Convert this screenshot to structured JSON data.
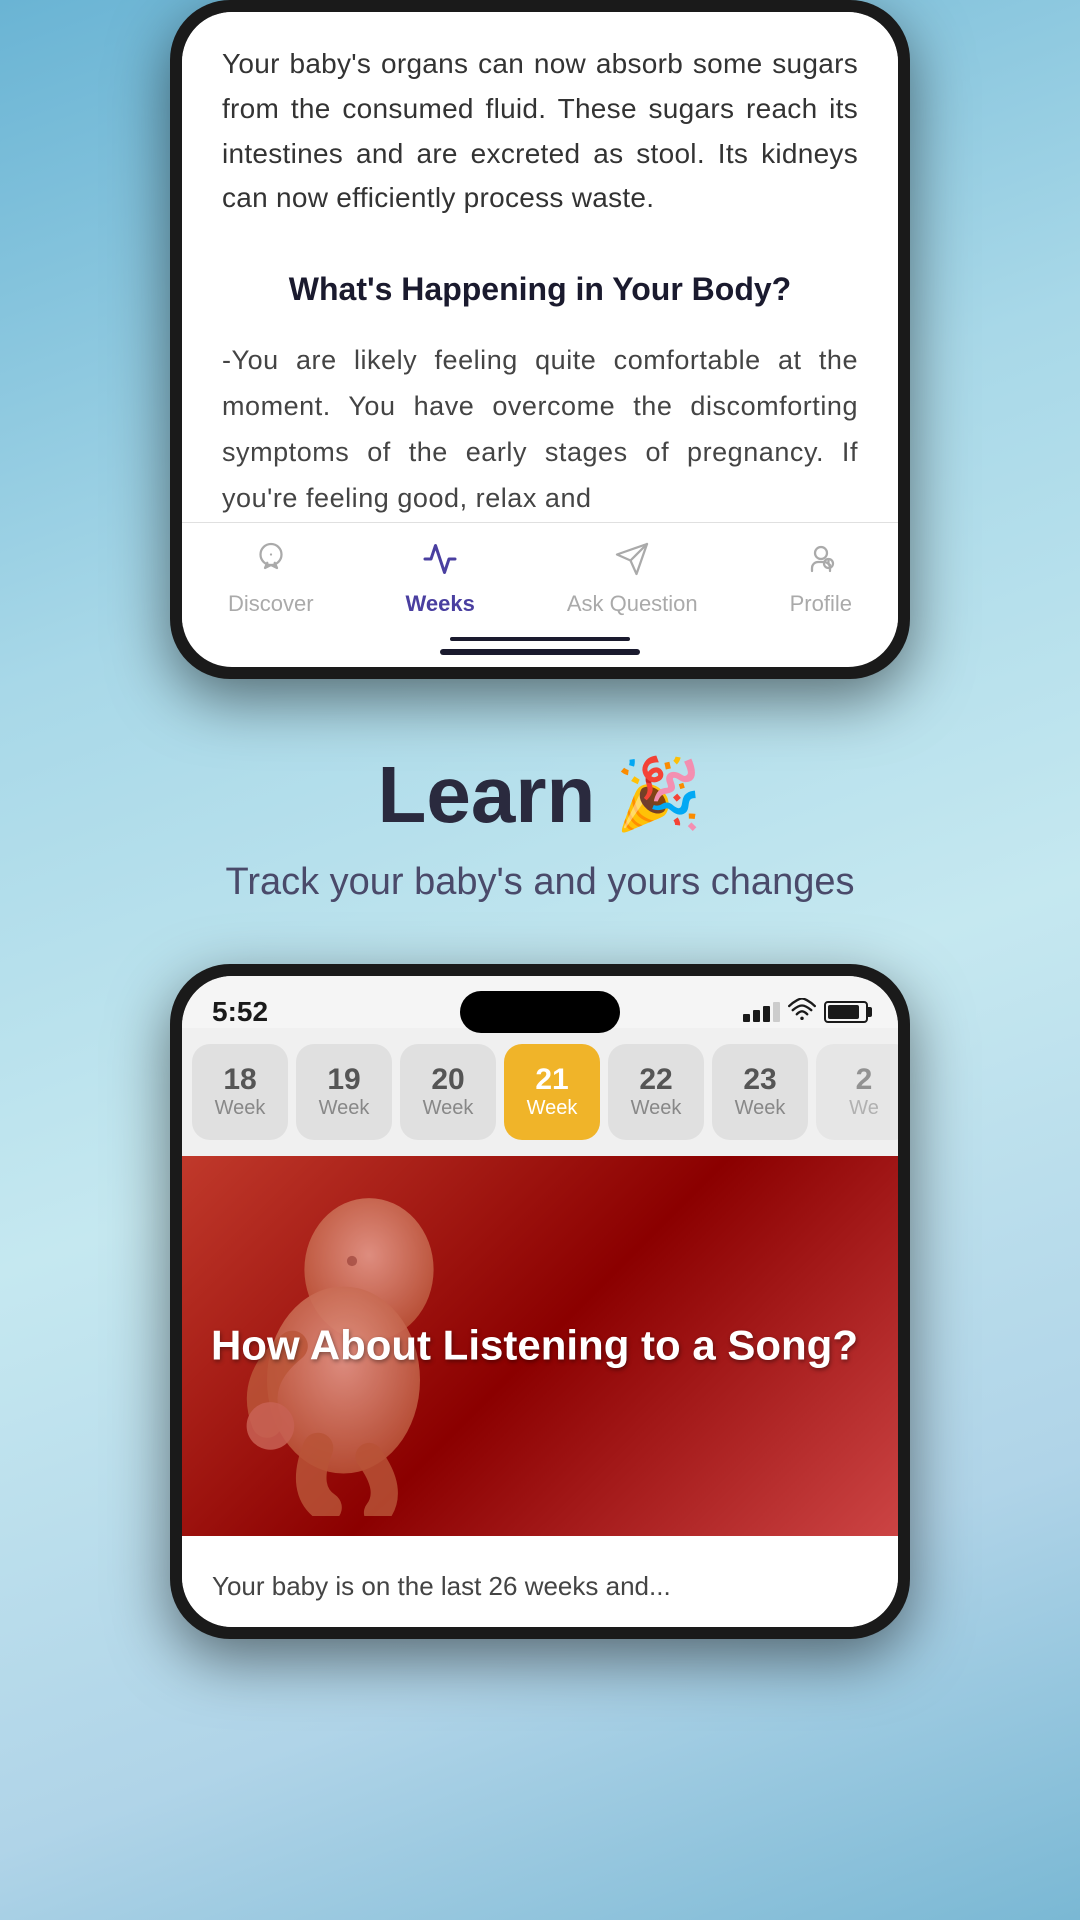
{
  "background": {
    "gradient_start": "#6ab4d4",
    "gradient_end": "#7ab8d4"
  },
  "top_phone": {
    "article_top": "Your baby's organs can now absorb some sugars from the consumed fluid. These sugars reach its intestines and are excreted as stool. Its kidneys can now efficiently process waste.",
    "section_heading": "What's Happening in Your Body?",
    "article_body": "-You are likely feeling quite comfortable at the moment. You have overcome the discomforting symptoms of the early stages of pregnancy. If you're feeling good, relax and"
  },
  "tab_bar": {
    "items": [
      {
        "id": "discover",
        "label": "Discover",
        "active": false
      },
      {
        "id": "weeks",
        "label": "Weeks",
        "active": true
      },
      {
        "id": "ask_question",
        "label": "Ask Question",
        "active": false
      },
      {
        "id": "profile",
        "label": "Profile",
        "active": false
      }
    ]
  },
  "middle_section": {
    "title": "Learn",
    "emoji": "🎉",
    "subtitle": "Track your baby's and yours changes"
  },
  "bottom_phone": {
    "status_bar": {
      "time": "5:52"
    },
    "weeks": [
      {
        "number": "18",
        "label": "Week",
        "active": false
      },
      {
        "number": "19",
        "label": "Week",
        "active": false
      },
      {
        "number": "20",
        "label": "Week",
        "active": false
      },
      {
        "number": "21",
        "label": "Week",
        "active": true
      },
      {
        "number": "22",
        "label": "Week",
        "active": false
      },
      {
        "number": "23",
        "label": "Week",
        "active": false
      },
      {
        "number": "2…",
        "label": "We…",
        "active": false
      }
    ],
    "banner": {
      "title": "How About Listening to a Song?"
    },
    "article_preview": "Your baby is on the last 26 weeks and..."
  },
  "bottom_caption": "Your baby is on the last 26 weeks and..."
}
